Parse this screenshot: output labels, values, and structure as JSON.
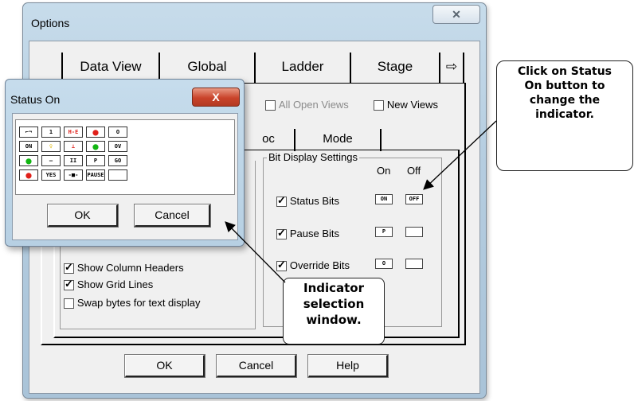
{
  "options_window": {
    "title": "Options",
    "close_glyph": "✕",
    "tabs_row1": [
      "Data View",
      "Global",
      "Ladder",
      "Stage"
    ],
    "tab_scroll_icon": "arrow-right-icon",
    "tab_scroll_glyph": "⇨",
    "apply_scope": {
      "all_open_views_label": "All Open Views",
      "all_open_views_checked": false,
      "new_views_label": "New Views",
      "new_views_checked": false
    },
    "tabs_row2": {
      "partial_label": "oc",
      "mode_label": "Mode"
    },
    "left_group": {
      "show_column_headers_label": "Show Column Headers",
      "show_column_headers_checked": true,
      "show_grid_lines_label": "Show Grid Lines",
      "show_grid_lines_checked": true,
      "swap_bytes_label": "Swap bytes for text display",
      "swap_bytes_checked": false
    },
    "bit_display": {
      "title": "Bit Display Settings",
      "on_header": "On",
      "off_header": "Off",
      "rows": [
        {
          "label": "Status Bits",
          "checked": true,
          "on": "ON",
          "off": "OFF"
        },
        {
          "label": "Pause Bits",
          "checked": true,
          "on": "P",
          "off": ""
        },
        {
          "label": "Override Bits",
          "checked": true,
          "on": "O",
          "off": ""
        }
      ]
    },
    "buttons": {
      "ok": "OK",
      "cancel": "Cancel",
      "help": "Help"
    }
  },
  "status_window": {
    "title": "Status On",
    "close_glyph": "X",
    "grid": [
      [
        "⌐¬",
        "1",
        "H-E",
        "●",
        "O"
      ],
      [
        "ON",
        "♀",
        "⊥",
        "●",
        "OV"
      ],
      [
        "●",
        "—",
        "II",
        "P",
        "GO"
      ],
      [
        "●",
        "YES",
        "-■-",
        "PAUSE",
        ""
      ]
    ],
    "buttons": {
      "ok": "OK",
      "cancel": "Cancel"
    }
  },
  "callouts": {
    "status_on_tip": "Click on Status On button to change the indicator.",
    "indicator_tip": "Indicator selection window."
  },
  "colors": {
    "red": "#e0201a",
    "green": "#12b512",
    "yellow": "#e0b400"
  }
}
